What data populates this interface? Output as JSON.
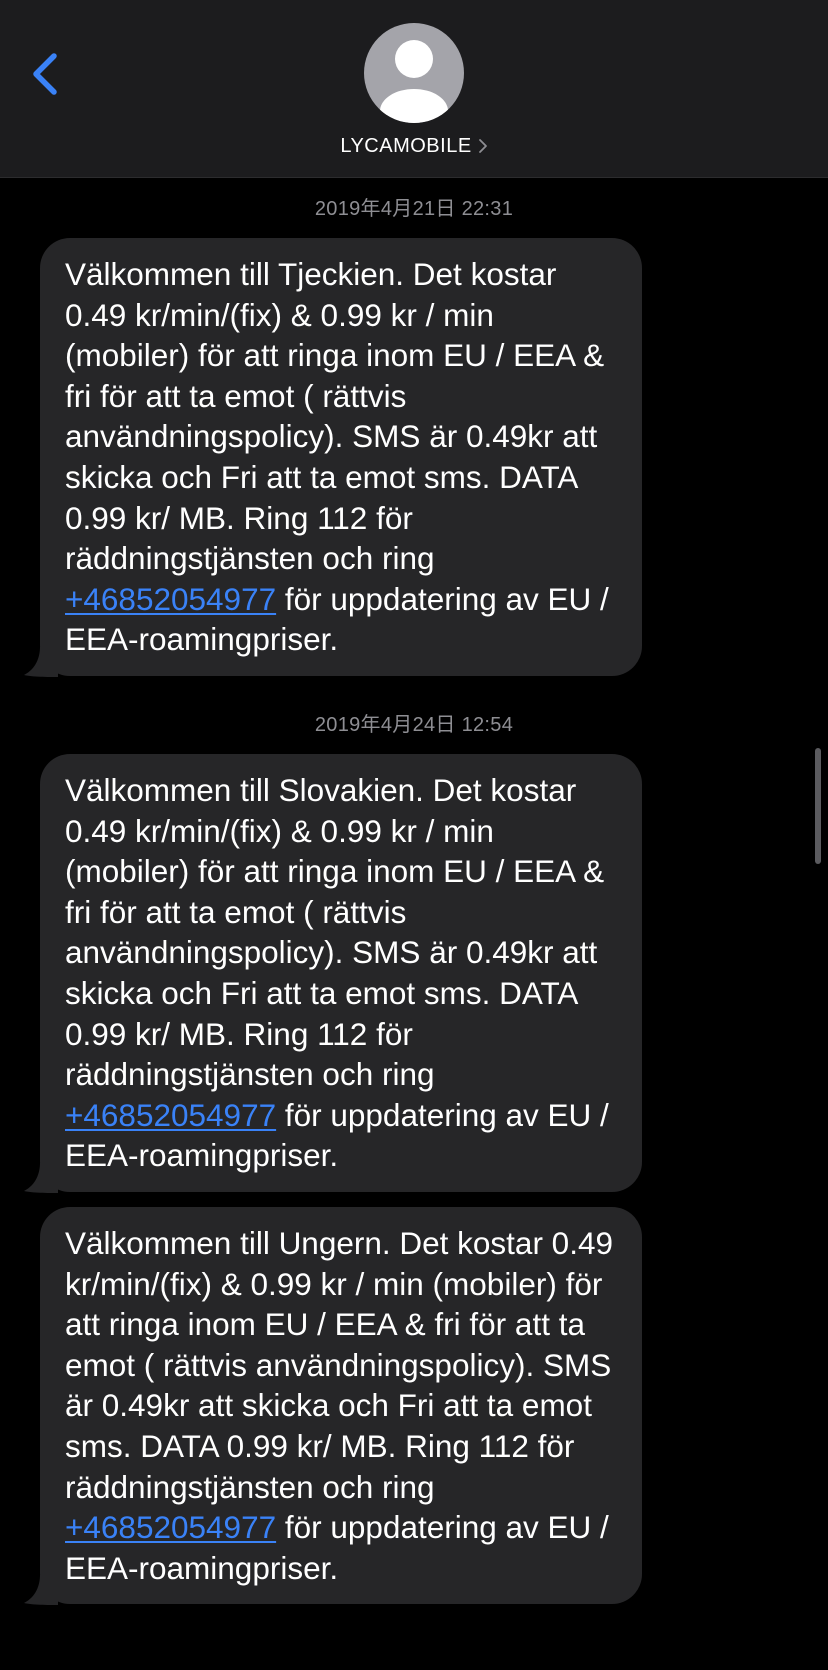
{
  "header": {
    "contact_name": "LYCAMOBILE",
    "back_icon": "chevron-left-icon",
    "avatar_icon": "person-icon",
    "disclosure_icon": "chevron-right-icon"
  },
  "messages": [
    {
      "timestamp": "2019年4月21日 22:31",
      "text": "Välkommen till Tjeckien. Det kostar 0.49 kr/min/(fix) & 0.99 kr / min (mobiler) för att ringa inom EU / EEA & fri för att ta emot ( rättvis användningspolicy). SMS är 0.49kr att skicka och Fri att ta emot sms. DATA 0.99 kr/ MB. Ring 112 för räddningstjänsten och ring",
      "link": "+46852054977",
      "text_after": " för uppdatering av EU / EEA-roamingpriser."
    },
    {
      "timestamp": "2019年4月24日 12:54",
      "text": "Välkommen till Slovakien. Det kostar 0.49 kr/min/(fix) & 0.99 kr / min (mobiler) för att ringa inom EU / EEA & fri för att ta emot ( rättvis användningspolicy). SMS är 0.49kr att skicka och Fri att ta emot sms. DATA 0.99 kr/ MB. Ring 112 för räddningstjänsten och ring",
      "link": "+46852054977",
      "text_after": " för uppdatering av EU / EEA-roamingpriser."
    },
    {
      "text": "Välkommen till Ungern. Det kostar 0.49 kr/min/(fix) & 0.99 kr / min (mobiler) för att ringa inom EU / EEA & fri för att ta emot ( rättvis användningspolicy). SMS är 0.49kr att skicka och Fri att ta emot sms. DATA 0.99 kr/ MB. Ring 112 för räddningstjänsten och ring",
      "link": "+46852054977",
      "text_after": " för uppdatering av EU / EEA-roamingpriser."
    }
  ],
  "colors": {
    "background": "#000000",
    "header_background": "#1c1c1e",
    "bubble": "#262628",
    "accent": "#3a82f7",
    "secondary_text": "#8e8e93"
  }
}
